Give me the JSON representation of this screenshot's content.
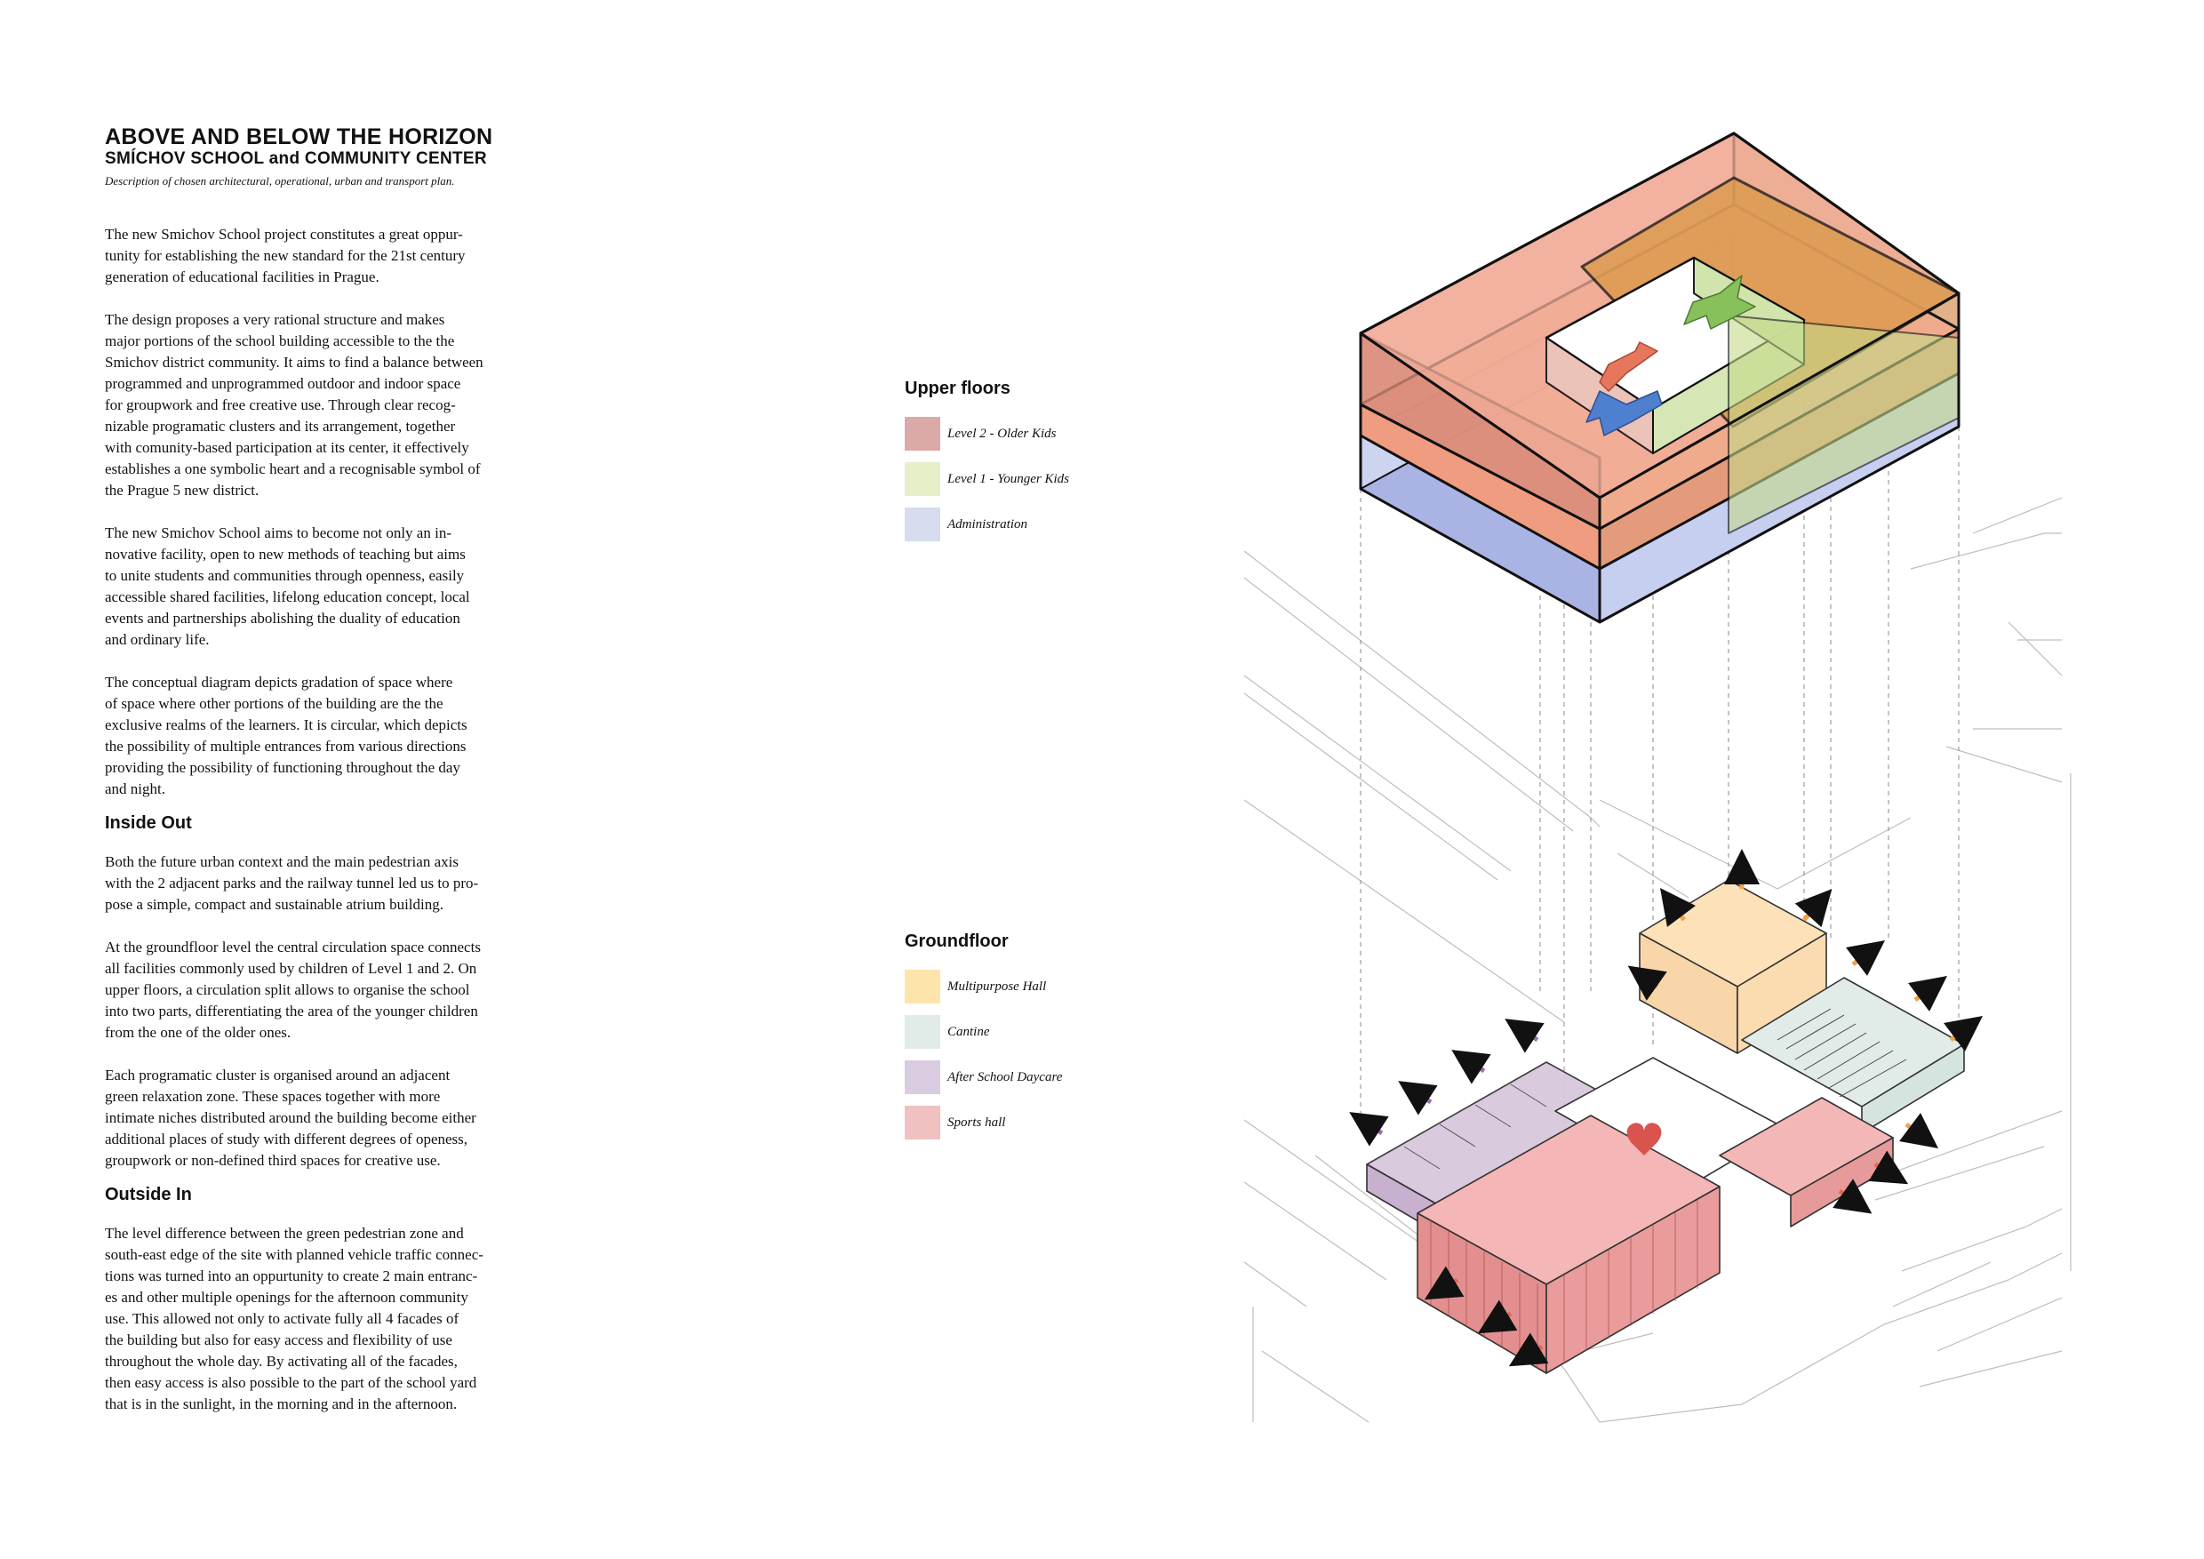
{
  "header": {
    "title": "ABOVE AND BELOW THE HORIZON",
    "subtitle": "SMÍCHOV SCHOOL and COMMUNITY CENTER",
    "description": "Description of chosen architectural, operational, urban and transport plan."
  },
  "body": {
    "p1": "The new Smichov School project constitutes a great oppur-\ntunity for establishing the new standard for the 21st century\ngeneration of educational facilities in Prague.",
    "p2": "The design proposes a very rational structure  and makes\nmajor portions of the school building accessible to the the\nSmichov district community. It aims to find a balance between\nprogrammed and unprogrammed outdoor and indoor space\nfor groupwork and free creative use. Through clear recog-\nnizable programatic clusters and its arrangement, together\nwith comunity-based participation at its center, it effectively\nestablishes a one symbolic heart and a recognisable symbol of\nthe Prague 5 new district.",
    "p3": "The new Smichov School aims to become not only an in-\nnovative facility, open to new methods of teaching but aims\nto unite students and communities through openness, easily\naccessible shared facilities, lifelong education concept, local\nevents and partnerships abolishing the duality of education\nand ordinary life.",
    "p4": "The conceptual diagram depicts gradation of space where\nof space where other portions of the building are the the\nexclusive realms of the learners. It is circular, which depicts\nthe possibility of multiple entrances from various directions\nproviding the possibility of functioning throughout the day\nand night.",
    "heading_inside": "Inside Out",
    "p5": "Both the future urban context and the main pedestrian axis\nwith the 2 adjacent parks and the railway tunnel led us to pro-\npose a simple, compact and sustainable atrium building.",
    "p6": "At the groundfloor level the central circulation space connects\nall facilities commonly used by children of Level 1 and 2. On\nupper floors, a circulation split allows to organise the school\ninto two parts, differentiating the area of the younger children\nfrom the one of the older ones.",
    "p7": "Each programatic cluster is organised around an adjacent\ngreen relaxation zone. These spaces together with more\nintimate niches distributed around the building become either\nadditional places of study with different degrees of openess,\ngroupwork or non-defined third spaces for creative use.",
    "heading_outside": "Outside In",
    "p8": "The level difference between the green pedestrian zone and\nsouth-east edge of the site with planned vehicle traffic connec-\ntions was turned into an oppurtunity to create 2 main entranc-\nes and other multiple openings for the afternoon community\nuse. This allowed not only to activate fully all 4 facades of\nthe building but also for easy access and flexibility of use\nthroughout the whole day. By activating all of the facades,\nthen easy access is also possible to the part of the school yard\nthat is in the sunlight, in the morning and in the afternoon."
  },
  "legend_upper": {
    "title": "Upper floors",
    "items": [
      {
        "label": "Level 2 - Older Kids",
        "color": "#dba9a7"
      },
      {
        "label": "Level 1 - Younger Kids",
        "color": "#e6efc7"
      },
      {
        "label": "Administration",
        "color": "#d7dcee"
      }
    ]
  },
  "legend_ground": {
    "title": "Groundfloor",
    "items": [
      {
        "label": "Multipurpose Hall",
        "color": "#fde4ab"
      },
      {
        "label": "Cantine",
        "color": "#e1ebe8"
      },
      {
        "label": "After School Daycare",
        "color": "#d9cce0"
      },
      {
        "label": "Sports hall",
        "color": "#f1c0c0"
      }
    ]
  }
}
